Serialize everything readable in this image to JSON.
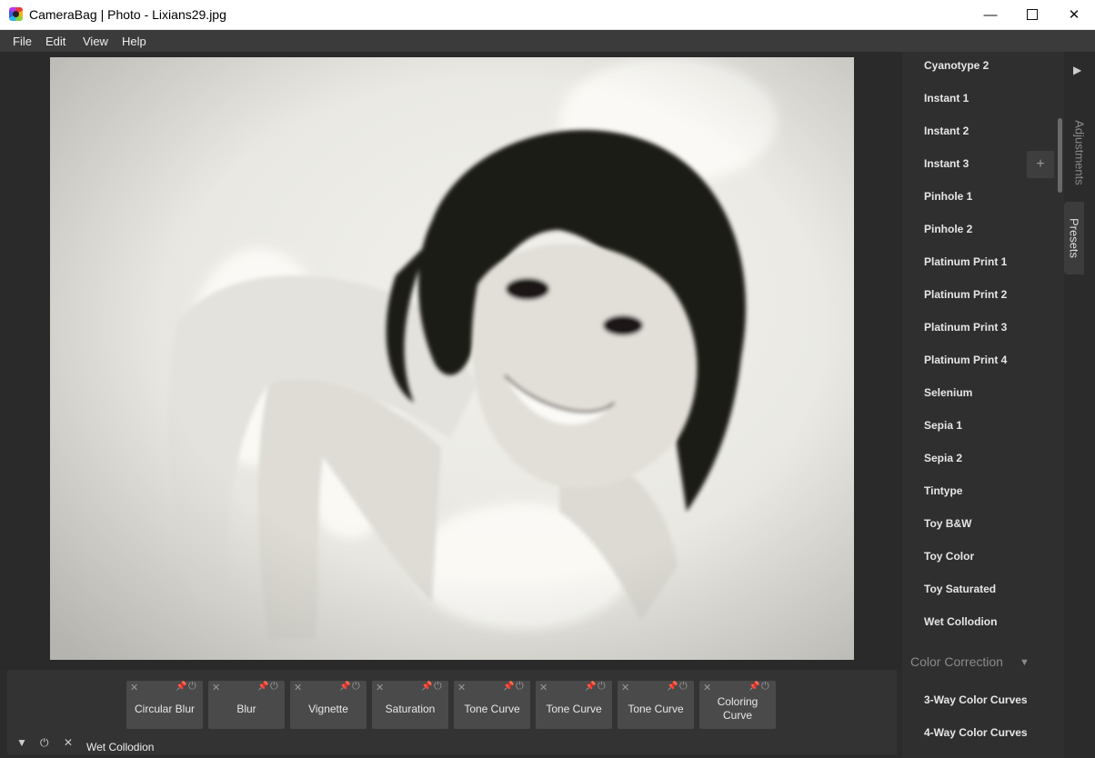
{
  "window": {
    "title": "CameraBag | Photo - Lixians29.jpg",
    "min_symbol": "—",
    "close_symbol": "✕"
  },
  "menu": [
    "File",
    "Edit",
    "View",
    "Help"
  ],
  "adjustments": [
    {
      "label": "Circular Blur"
    },
    {
      "label": "Blur"
    },
    {
      "label": "Vignette"
    },
    {
      "label": "Saturation"
    },
    {
      "label": "Tone Curve"
    },
    {
      "label": "Tone Curve"
    },
    {
      "label": "Tone Curve"
    },
    {
      "label": "Coloring Curve"
    }
  ],
  "icons": {
    "remove": "✕",
    "pin": "📌",
    "power": "⏻",
    "collapse": "▼",
    "expand": "▶",
    "add": "+",
    "dropdown": "▼"
  },
  "bottom": {
    "preset_name": "Wet Collodion"
  },
  "presets": [
    "Cyanotype 2",
    "Instant 1",
    "Instant 2",
    "Instant 3",
    "Pinhole 1",
    "Pinhole 2",
    "Platinum Print 1",
    "Platinum Print 2",
    "Platinum Print 3",
    "Platinum Print 4",
    "Selenium",
    "Sepia 1",
    "Sepia 2",
    "Tintype",
    "Toy B&W",
    "Toy Color",
    "Toy Saturated",
    "Wet Collodion"
  ],
  "color_correction": {
    "header": "Color Correction",
    "items": [
      "3-Way Color Curves",
      "4-Way Color Curves"
    ]
  },
  "tabs": {
    "adjustments": "Adjustments",
    "presets": "Presets"
  }
}
